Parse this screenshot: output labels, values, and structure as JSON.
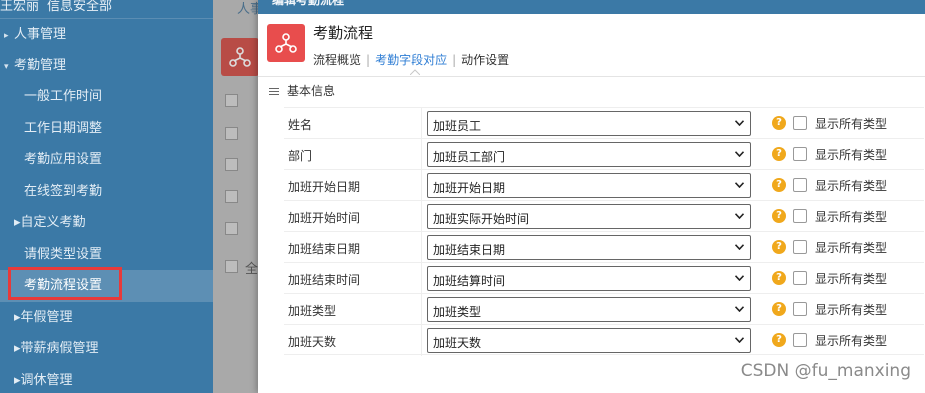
{
  "sidebar": {
    "user_name": "王宏丽",
    "user_dept": "信息安全部",
    "items": [
      {
        "label": "人事管理",
        "type": "group"
      },
      {
        "label": "考勤管理",
        "type": "group-open"
      },
      {
        "label": "一般工作时间",
        "type": "sub"
      },
      {
        "label": "工作日期调整",
        "type": "sub"
      },
      {
        "label": "考勤应用设置",
        "type": "sub"
      },
      {
        "label": "在线签到考勤",
        "type": "sub"
      },
      {
        "label": "自定义考勤",
        "type": "sub-group"
      },
      {
        "label": "请假类型设置",
        "type": "sub"
      },
      {
        "label": "考勤流程设置",
        "type": "sub-active"
      },
      {
        "label": "年假管理",
        "type": "sub-group"
      },
      {
        "label": "带薪病假管理",
        "type": "sub-group"
      },
      {
        "label": "调休管理",
        "type": "sub-group"
      }
    ]
  },
  "background": {
    "tab_label": "人事",
    "select_all_label": "全"
  },
  "modal": {
    "title": "编辑考勤流程",
    "header_title": "考勤流程",
    "tabs": [
      {
        "label": "流程概览",
        "active": false
      },
      {
        "label": "考勤字段对应",
        "active": true
      },
      {
        "label": "动作设置",
        "active": false
      }
    ],
    "section_title": "基本信息",
    "help_glyph": "?",
    "rows": [
      {
        "label": "姓名",
        "value": "加班员工",
        "checkbox_label": "显示所有类型",
        "checked": false
      },
      {
        "label": "部门",
        "value": "加班员工部门",
        "checkbox_label": "显示所有类型",
        "checked": false
      },
      {
        "label": "加班开始日期",
        "value": "加班开始日期",
        "checkbox_label": "显示所有类型",
        "checked": false
      },
      {
        "label": "加班开始时间",
        "value": "加班实际开始时间",
        "checkbox_label": "显示所有类型",
        "checked": false
      },
      {
        "label": "加班结束日期",
        "value": "加班结束日期",
        "checkbox_label": "显示所有类型",
        "checked": false
      },
      {
        "label": "加班结束时间",
        "value": "加班结算时间",
        "checkbox_label": "显示所有类型",
        "checked": false
      },
      {
        "label": "加班类型",
        "value": "加班类型",
        "checkbox_label": "显示所有类型",
        "checked": false
      },
      {
        "label": "加班天数",
        "value": "加班天数",
        "checkbox_label": "显示所有类型",
        "checked": false
      }
    ]
  },
  "watermark": "CSDN @fu_manxing",
  "colors": {
    "sidebar_bg": "#3b79a6",
    "accent": "#2e7dd4",
    "logo_red": "#e84d4d",
    "help_orange": "#f0a81c",
    "highlight_box": "#e83a3a"
  },
  "icons": {
    "logo": "workflow-nodes-icon",
    "help": "question-circle-icon",
    "select": "chevron-down-icon",
    "section": "list-lines-icon"
  }
}
